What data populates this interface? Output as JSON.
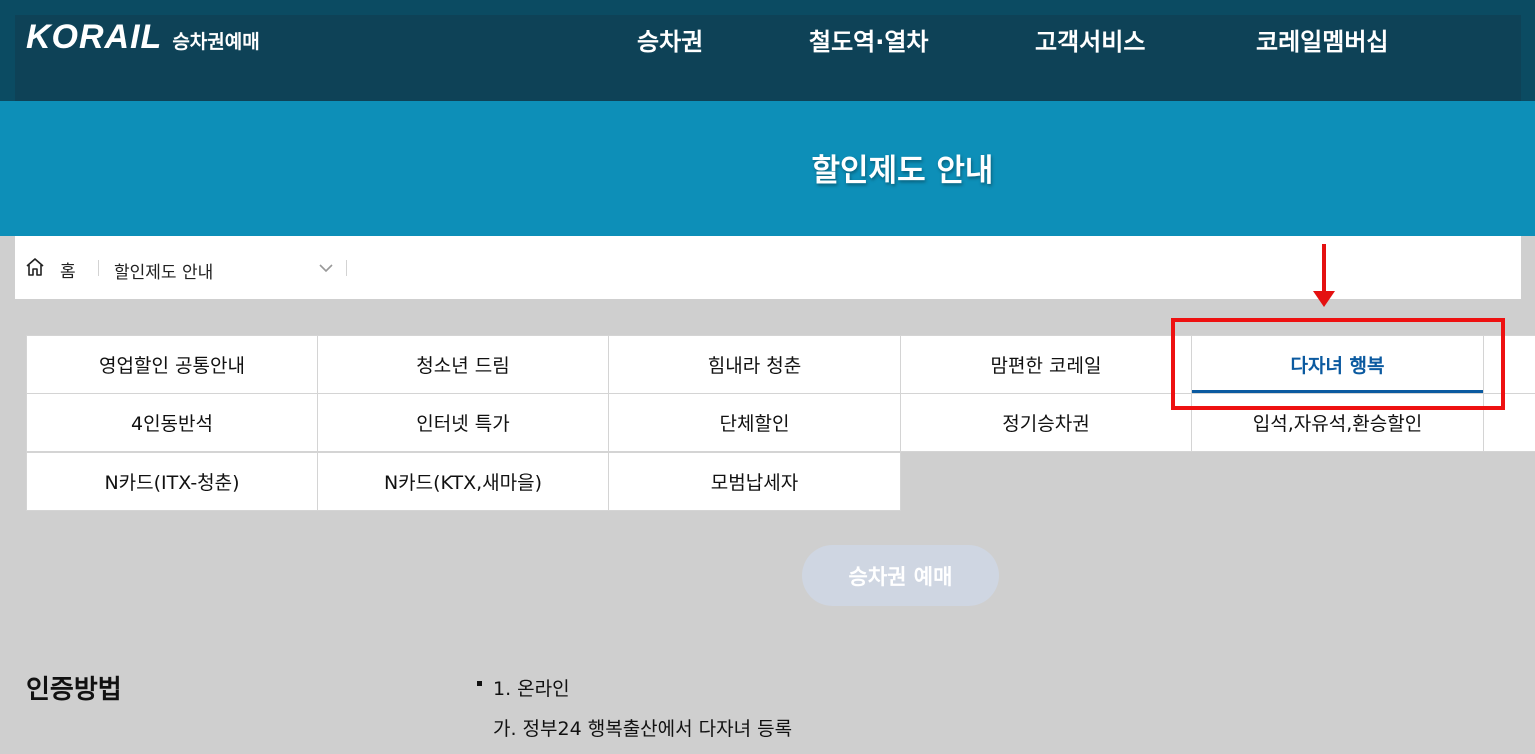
{
  "header": {
    "logo": "KORAIL",
    "logo_sub": "승차권예매",
    "nav": [
      "승차권",
      "철도역·열차",
      "고객서비스",
      "코레일멤버십"
    ]
  },
  "hero": {
    "title": "할인제도 안내"
  },
  "breadcrumb": {
    "home": "홈",
    "current": "할인제도 안내"
  },
  "tabs": [
    [
      "영업할인 공통안내",
      "청소년 드림",
      "힘내라 청춘",
      "맘편한 코레일",
      "다자녀 행복"
    ],
    [
      "4인동반석",
      "인터넷 특가",
      "단체할인",
      "정기승차권",
      "입석,자유석,환승할인"
    ],
    [
      "N카드(ITX-청춘)",
      "N카드(KTX,새마을)",
      "모범납세자"
    ]
  ],
  "active_tab": "다자녀 행복",
  "book_button": "승차권 예매",
  "section": {
    "title": "인증방법",
    "line1": "1. 온라인",
    "line2": "가. 정부24 행복출산에서 다자녀 등록"
  },
  "colors": {
    "header_dark": "#0e4257",
    "hero_blue": "#0d8fb8",
    "active_tab": "#0b5aa0",
    "highlight_red": "#ee1111",
    "button_disabled": "#cfd6e2"
  }
}
